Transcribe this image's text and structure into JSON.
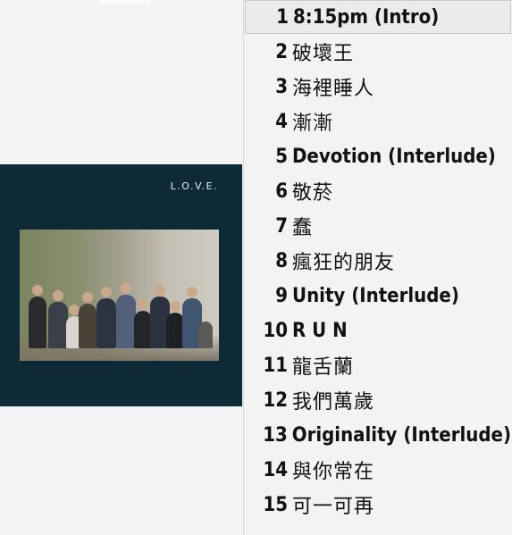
{
  "album": {
    "cover_text": "L.O.V.E.",
    "colors": {
      "cover_bg": "#0f2a37",
      "photo_left": "#7b8461",
      "photo_right": "#cfccc2"
    }
  },
  "tracklist": {
    "selected_index": 0,
    "tracks": [
      {
        "number": "1",
        "title": "8:15pm (Intro)",
        "cjk": false
      },
      {
        "number": "2",
        "title": "破壞王",
        "cjk": true
      },
      {
        "number": "3",
        "title": "海裡睡人",
        "cjk": true
      },
      {
        "number": "4",
        "title": "漸漸",
        "cjk": true
      },
      {
        "number": "5",
        "title": "Devotion (Interlude)",
        "cjk": false
      },
      {
        "number": "6",
        "title": "敬菸",
        "cjk": true
      },
      {
        "number": "7",
        "title": "蠢",
        "cjk": true
      },
      {
        "number": "8",
        "title": "瘋狂的朋友",
        "cjk": true
      },
      {
        "number": "9",
        "title": "Unity (Interlude)",
        "cjk": false
      },
      {
        "number": "10",
        "title": "R U N",
        "cjk": false
      },
      {
        "number": "11",
        "title": "龍舌蘭",
        "cjk": true
      },
      {
        "number": "12",
        "title": "我們萬歲",
        "cjk": true
      },
      {
        "number": "13",
        "title": "Originality (Interlude)",
        "cjk": false
      },
      {
        "number": "14",
        "title": "與你常在",
        "cjk": true
      },
      {
        "number": "15",
        "title": "可一可再",
        "cjk": true
      }
    ]
  }
}
